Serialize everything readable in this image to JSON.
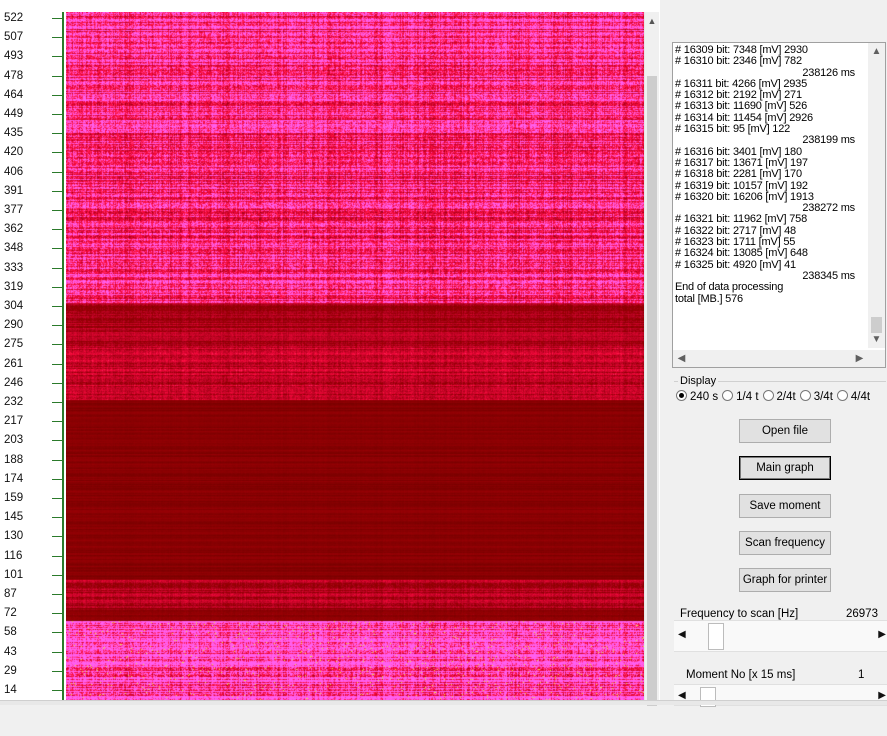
{
  "axis": {
    "ticks": [
      "522",
      "507",
      "493",
      "478",
      "464",
      "449",
      "435",
      "420",
      "406",
      "391",
      "377",
      "362",
      "348",
      "333",
      "319",
      "304",
      "290",
      "275",
      "261",
      "246",
      "232",
      "217",
      "203",
      "188",
      "174",
      "159",
      "145",
      "130",
      "116",
      "101",
      "87",
      "72",
      "58",
      "43",
      "29",
      "14"
    ]
  },
  "log": {
    "lines": [
      {
        "text": "# 16309 bit: 7348 [mV] 2930",
        "kind": "entry"
      },
      {
        "text": "# 16310 bit: 2346 [mV] 782",
        "kind": "entry"
      },
      {
        "text": "238126 ms",
        "kind": "ms"
      },
      {
        "text": "# 16311 bit: 4266 [mV] 2935",
        "kind": "entry"
      },
      {
        "text": "# 16312 bit: 2192 [mV] 271",
        "kind": "entry"
      },
      {
        "text": "# 16313 bit: 11690 [mV] 526",
        "kind": "entry"
      },
      {
        "text": "# 16314 bit: 11454 [mV] 2926",
        "kind": "entry"
      },
      {
        "text": "# 16315 bit: 95 [mV] 122",
        "kind": "entry"
      },
      {
        "text": "238199 ms",
        "kind": "ms"
      },
      {
        "text": "# 16316 bit: 3401 [mV] 180",
        "kind": "entry"
      },
      {
        "text": "# 16317 bit: 13671 [mV] 197",
        "kind": "entry"
      },
      {
        "text": "# 16318 bit: 2281 [mV] 170",
        "kind": "entry"
      },
      {
        "text": "# 16319 bit: 10157 [mV] 192",
        "kind": "entry"
      },
      {
        "text": "# 16320 bit: 16206 [mV] 1913",
        "kind": "entry"
      },
      {
        "text": "238272 ms",
        "kind": "ms"
      },
      {
        "text": "# 16321 bit: 11962 [mV] 758",
        "kind": "entry"
      },
      {
        "text": "# 16322 bit: 2717 [mV] 48",
        "kind": "entry"
      },
      {
        "text": "# 16323 bit: 1711 [mV] 55",
        "kind": "entry"
      },
      {
        "text": "# 16324 bit: 13085 [mV] 648",
        "kind": "entry"
      },
      {
        "text": "# 16325 bit: 4920 [mV] 41",
        "kind": "entry"
      },
      {
        "text": "238345 ms",
        "kind": "ms"
      },
      {
        "text": "End of data processing",
        "kind": "entry"
      },
      {
        "text": "total [MB.] 576",
        "kind": "entry"
      }
    ]
  },
  "display": {
    "title": "Display",
    "options": [
      "240 s",
      "1/4 t",
      "2/4t",
      "3/4t",
      "4/4t"
    ],
    "selected": "240 s"
  },
  "buttons": {
    "open_file": "Open file",
    "main_graph": "Main graph",
    "save_moment": "Save moment",
    "scan_frequency": "Scan frequency",
    "graph_for_printer": "Graph for printer"
  },
  "frequency": {
    "label": "Frequency to scan [Hz]",
    "value": "26973",
    "slider_fraction": 0.1
  },
  "moment": {
    "label": "Moment No [x 15 ms]",
    "value": "1",
    "slider_fraction": 0.05
  },
  "colors": {
    "spectrogram_bright": "#e0003c",
    "spectrogram_dark": "#7a0000",
    "spectrogram_magenta": "#ff2fb0",
    "axis_green": "#2b7a2b"
  },
  "icons": {
    "scroll_up": "▲",
    "scroll_down": "▼",
    "scroll_left": "◀",
    "scroll_right": "▶"
  }
}
